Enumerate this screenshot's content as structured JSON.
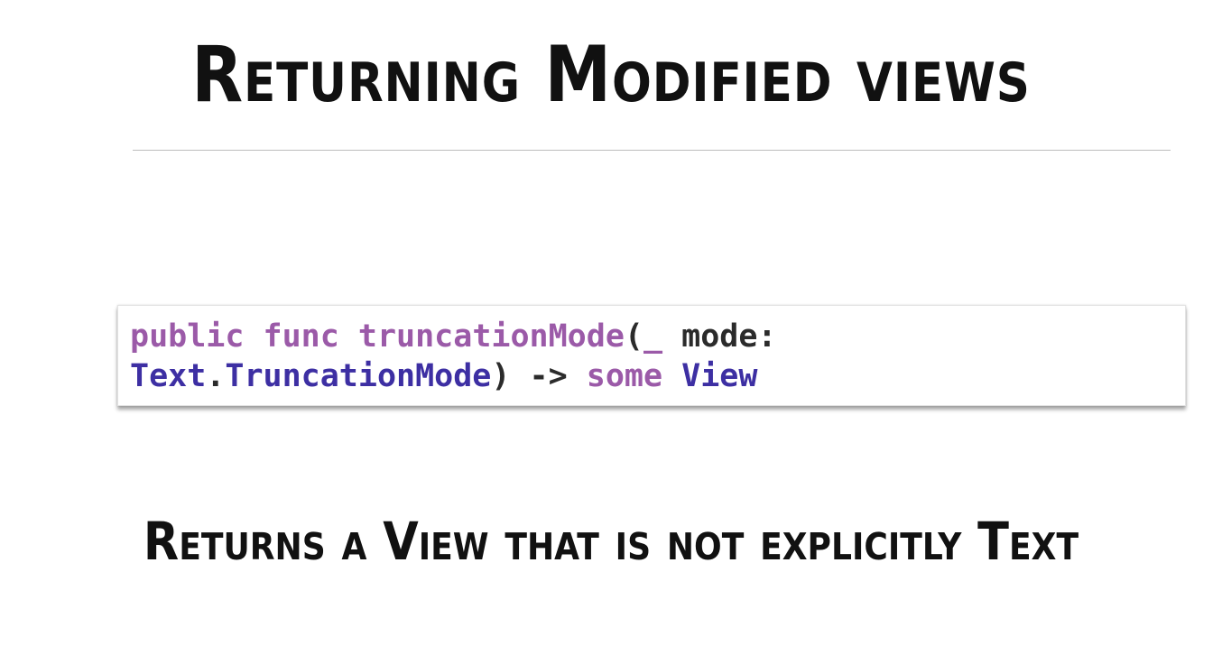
{
  "slide": {
    "title": "Returning Modified views",
    "code": {
      "line1": [
        {
          "text": "public",
          "kind": "keyword"
        },
        {
          "text": " ",
          "kind": "plain"
        },
        {
          "text": "func",
          "kind": "keyword"
        },
        {
          "text": " ",
          "kind": "plain"
        },
        {
          "text": "truncationMode",
          "kind": "keyword"
        },
        {
          "text": "(",
          "kind": "plain"
        },
        {
          "text": "_",
          "kind": "keyword"
        },
        {
          "text": " mode:",
          "kind": "plain"
        }
      ],
      "line2": [
        {
          "text": "Text",
          "kind": "type"
        },
        {
          "text": ".",
          "kind": "plain"
        },
        {
          "text": "TruncationMode",
          "kind": "type"
        },
        {
          "text": ") -> ",
          "kind": "plain"
        },
        {
          "text": "some",
          "kind": "keyword"
        },
        {
          "text": " ",
          "kind": "plain"
        },
        {
          "text": "View",
          "kind": "type"
        }
      ]
    },
    "subtitle": "Returns a View that is not explicitly Text"
  },
  "colors": {
    "keyword": "#9b5aa8",
    "type": "#3d2fa3",
    "plain": "#2b2b2b",
    "text": "#111111",
    "rule": "#bdbdbd"
  }
}
